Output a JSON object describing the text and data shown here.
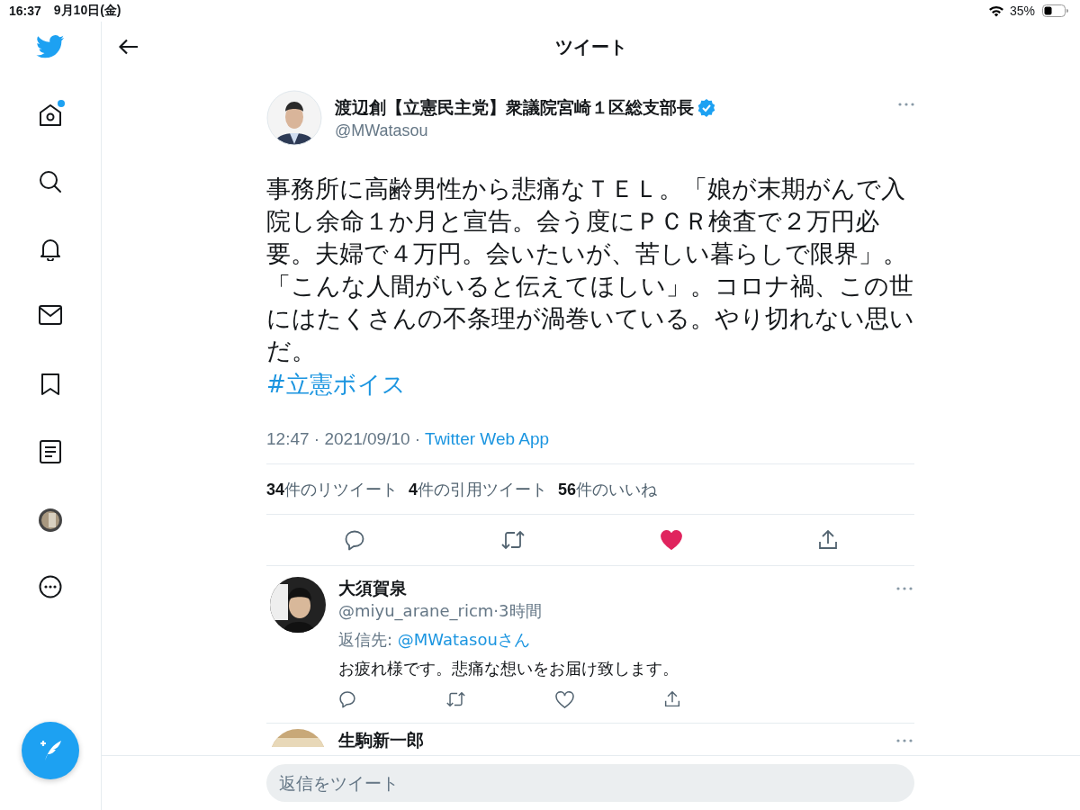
{
  "status_bar": {
    "time": "16:37",
    "date": "9月10日(金)",
    "battery": "35%"
  },
  "sidebar": {
    "items": [
      {
        "kind": "logo",
        "notification": false
      },
      {
        "kind": "home",
        "notification": true
      },
      {
        "kind": "search",
        "notification": false
      },
      {
        "kind": "bell",
        "notification": false
      },
      {
        "kind": "mail",
        "notification": false
      },
      {
        "kind": "bookmark",
        "notification": false
      },
      {
        "kind": "list",
        "notification": false
      },
      {
        "kind": "avatar",
        "notification": false
      },
      {
        "kind": "more",
        "notification": false
      }
    ]
  },
  "header": {
    "title": "ツイート"
  },
  "tweet": {
    "name": "渡辺創【立憲民主党】衆議院宮崎１区総支部長",
    "verified": true,
    "handle": "@MWatasou",
    "text": "事務所に高齢男性から悲痛なＴＥＬ。「娘が末期がんで入院し余命１か月と宣告。会う度にＰＣＲ検査で２万円必要。夫婦で４万円。会いたいが、苦しい暮らしで限界」。「こんな人間がいると伝えてほしい」。コロナ禍、この世にはたくさんの不条理が渦巻いている。やり切れない思いだ。",
    "hashtag": "#立憲ボイス",
    "timestamp": "12:47 · 2021/09/10 · ",
    "source": "Twitter Web App",
    "stats": [
      {
        "count": "34",
        "label": "件のリツイート"
      },
      {
        "count": "4",
        "label": "件の引用ツイート"
      },
      {
        "count": "56",
        "label": "件のいいね"
      }
    ],
    "liked": true
  },
  "replies": [
    {
      "name": "大須賀泉",
      "meta": "@miyu_arane_ricm·3時間",
      "reply_prefix": "返信先: ",
      "reply_to": "@MWatasouさん",
      "text": "お疲れ様です。悲痛な想いをお届け致します。",
      "liked": false
    },
    {
      "name": "生駒新一郎"
    }
  ],
  "reply_box": {
    "placeholder": "返信をツイート"
  }
}
